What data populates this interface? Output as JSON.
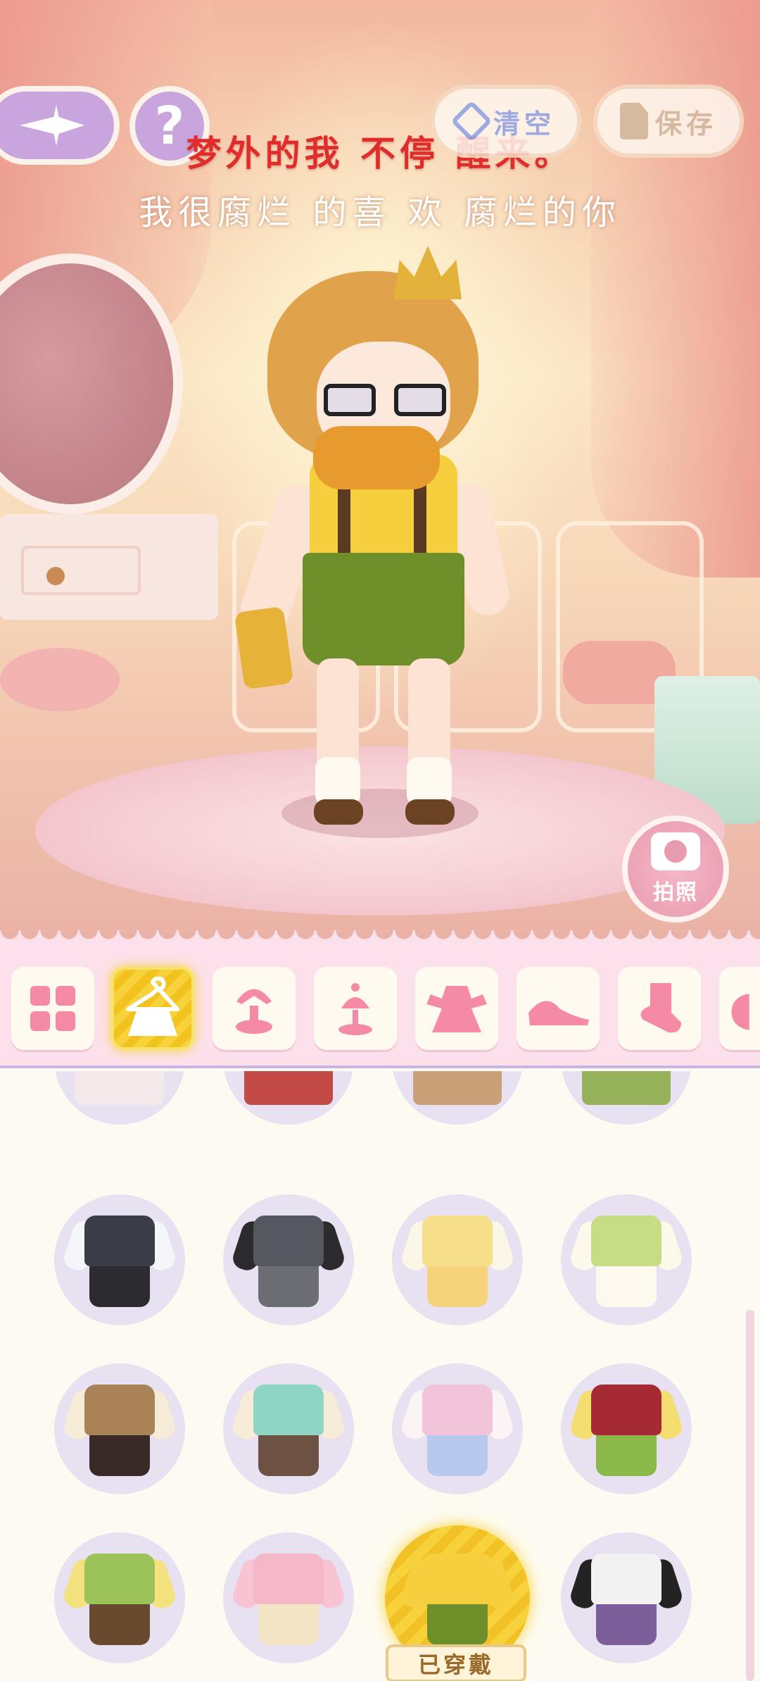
{
  "lyrics": {
    "line1": "梦外的我 不停 醒来。",
    "line2": "我很腐烂 的喜 欢 腐烂的你"
  },
  "top_bar": {
    "back_icon": "sparkle-arrow-left-icon",
    "help_label": "?",
    "clear_label": "清空",
    "save_label": "保存"
  },
  "photo": {
    "label": "拍照"
  },
  "categories": [
    {
      "name": "all",
      "icon": "grid-icon",
      "active": false
    },
    {
      "name": "suits",
      "icon": "hanger-outfit-icon",
      "active": true
    },
    {
      "name": "hair",
      "icon": "hair-icon",
      "active": false
    },
    {
      "name": "headwear",
      "icon": "hat-icon",
      "active": false
    },
    {
      "name": "dress",
      "icon": "dress-icon",
      "active": false
    },
    {
      "name": "shoes",
      "icon": "shoe-icon",
      "active": false
    },
    {
      "name": "socks",
      "icon": "sock-icon",
      "active": false
    },
    {
      "name": "more",
      "icon": "partial-icon",
      "active": false
    }
  ],
  "items": [
    {
      "name": "black-lolita-dress",
      "top": "#2b2b2b",
      "bottom": "#f4e9ea",
      "style": "dress"
    },
    {
      "name": "red-plaid-dress",
      "top": "#b53a35",
      "bottom": "#c44b45",
      "style": "dress"
    },
    {
      "name": "brown-plaid-dress",
      "top": "#8a5a35",
      "bottom": "#c9a078",
      "style": "dress"
    },
    {
      "name": "green-plaid-dress",
      "top": "#7d9a3e",
      "bottom": "#96b25a",
      "style": "dress"
    },
    {
      "name": "argyle-vest-suit",
      "top": "#3a3d45",
      "bottom": "#2c2c30",
      "style": "suit",
      "sleeve": "#f4f6fa"
    },
    {
      "name": "grey-vest-suit",
      "top": "#56585f",
      "bottom": "#6b6d73",
      "style": "suit",
      "sleeve": "#2b2b2e"
    },
    {
      "name": "yellow-vest-suit",
      "top": "#f7de8a",
      "bottom": "#f5d37a",
      "style": "suit",
      "sleeve": "#fbf6e6"
    },
    {
      "name": "green-check-blouse",
      "top": "#c6dd84",
      "bottom": "#fdf9ee",
      "style": "top",
      "sleeve": "#fcf8ea"
    },
    {
      "name": "tan-vest-suit",
      "top": "#a88357",
      "bottom": "#3a2a25",
      "style": "suit",
      "sleeve": "#f6ecd8"
    },
    {
      "name": "mint-vest-suit",
      "top": "#8ed5c3",
      "bottom": "#6d5142",
      "style": "suit",
      "sleeve": "#f6ecd8"
    },
    {
      "name": "pink-vest-suit",
      "top": "#f1c4d9",
      "bottom": "#b7c9ec",
      "style": "suit",
      "sleeve": "#fbf3f4"
    },
    {
      "name": "red-vest-green-shorts",
      "top": "#a62a33",
      "bottom": "#8ab94a",
      "style": "suit",
      "sleeve": "#f4dd71"
    },
    {
      "name": "green-vest-brown-shorts",
      "top": "#9cc25a",
      "bottom": "#6a4a2e",
      "style": "suit",
      "sleeve": "#f4e27f"
    },
    {
      "name": "pink-shirt-cream-shorts",
      "top": "#f5b8c9",
      "bottom": "#f5e5c7",
      "style": "suit",
      "sleeve": "#f8c3d2"
    },
    {
      "name": "yellow-shirt-green-shorts",
      "top": "#f6cf3e",
      "bottom": "#6f8f2a",
      "style": "suit",
      "sleeve": "#f6cf3e",
      "worn": true
    },
    {
      "name": "white-hoodie-checker-shorts",
      "top": "#f2f2f2",
      "bottom": "#7b5e9a",
      "style": "suit",
      "sleeve": "#232323"
    }
  ],
  "worn_label": "已穿戴",
  "colors": {
    "accent_pink": "#f48aa6",
    "active_yellow": "#f7d23b",
    "lyric_red": "#e12c2c",
    "clear_blue": "#8fa4e9"
  }
}
